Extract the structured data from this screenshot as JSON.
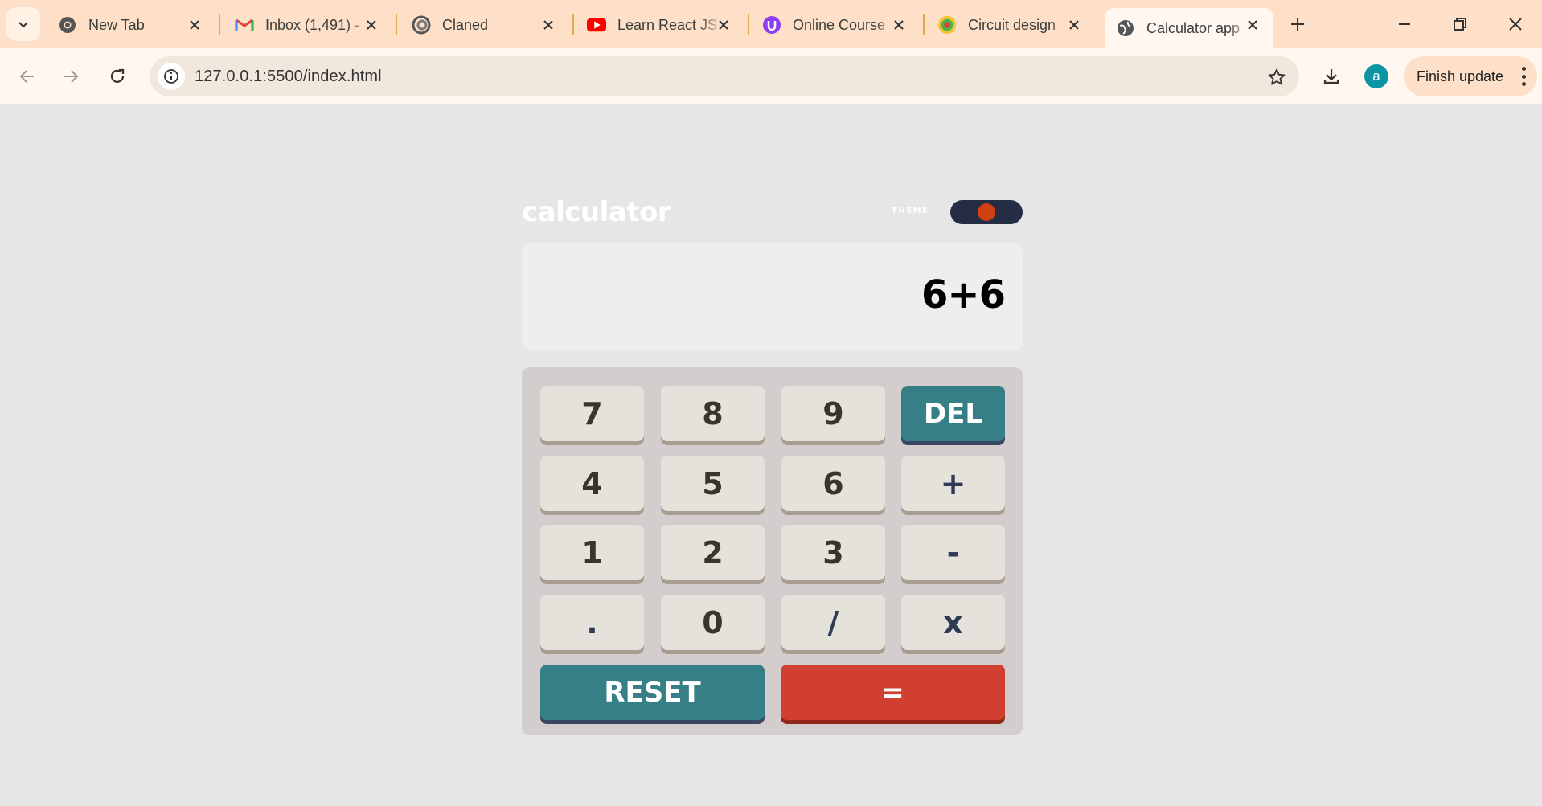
{
  "browser": {
    "tabs": [
      {
        "label": "New Tab",
        "icon": "chrome-icon"
      },
      {
        "label": "Inbox (1,491) -",
        "icon": "gmail-icon"
      },
      {
        "label": "Claned",
        "icon": "claned-icon"
      },
      {
        "label": "Learn React JS",
        "icon": "youtube-icon"
      },
      {
        "label": "Online Course",
        "icon": "udemy-icon"
      },
      {
        "label": "Circuit design",
        "icon": "circuit-icon"
      },
      {
        "label": "Calculator app",
        "icon": "globe-icon",
        "active": true
      }
    ],
    "url": "127.0.0.1:5500/index.html",
    "profile_initial": "a",
    "update_button": "Finish update",
    "colors": {
      "tabstrip": "#fde0c7",
      "toolbar": "#fff7f0",
      "avatar": "#0d95a6"
    }
  },
  "calculator": {
    "title": "calculator",
    "theme_label": "THEME",
    "display": "6+6",
    "keys": {
      "k7": "7",
      "k8": "8",
      "k9": "9",
      "del": "DEL",
      "k4": "4",
      "k5": "5",
      "k6": "6",
      "plus": "+",
      "k1": "1",
      "k2": "2",
      "k3": "3",
      "minus": "-",
      "dot": ".",
      "k0": "0",
      "divide": "/",
      "multiply": "x",
      "reset": "RESET",
      "equals": "="
    },
    "colors": {
      "page": "#e6e6e6",
      "screen": "#eeeeee",
      "keypad": "#d3cdcd",
      "key": "#e5e2dc",
      "del_reset": "#377f86",
      "equals": "#d03f2f",
      "toggle": "#242d44",
      "knob": "#d03f0f"
    }
  }
}
